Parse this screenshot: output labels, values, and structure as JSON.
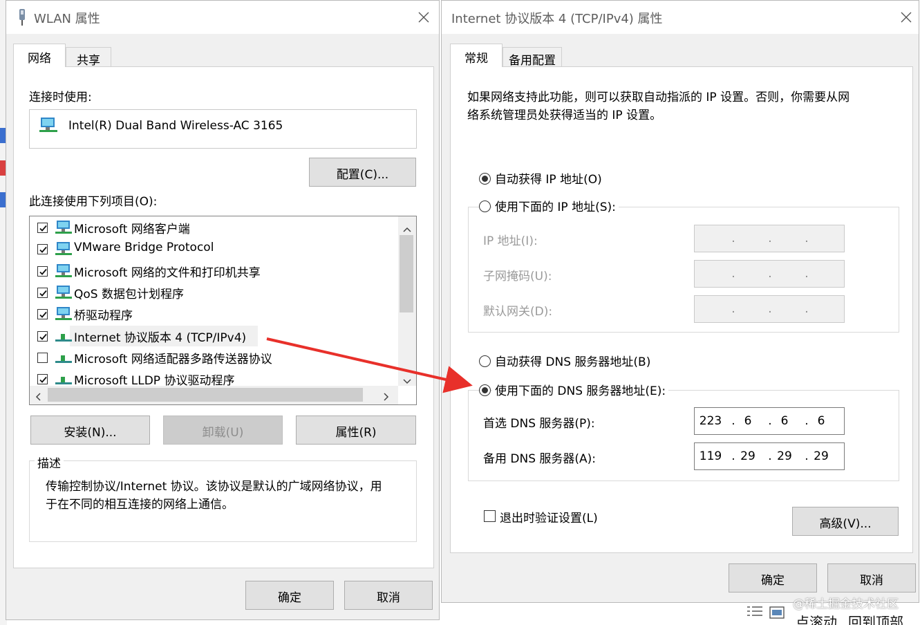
{
  "wlan_window": {
    "title": "WLAN 属性",
    "tabs": [
      "网络",
      "共享"
    ],
    "connect_using_label": "连接时使用:",
    "adapter_name": "Intel(R) Dual Band Wireless-AC 3165",
    "configure_button": "配置(C)...",
    "items_label": "此连接使用下列项目(O):",
    "items": [
      {
        "label": "Microsoft 网络客户端",
        "checked": true,
        "icon": "network-client-icon"
      },
      {
        "label": "VMware Bridge Protocol",
        "checked": true,
        "icon": "network-client-icon"
      },
      {
        "label": "Microsoft 网络的文件和打印机共享",
        "checked": true,
        "icon": "network-client-icon"
      },
      {
        "label": "QoS 数据包计划程序",
        "checked": true,
        "icon": "network-client-icon"
      },
      {
        "label": "桥驱动程序",
        "checked": true,
        "icon": "network-client-icon"
      },
      {
        "label": "Internet 协议版本 4 (TCP/IPv4)",
        "checked": true,
        "icon": "protocol-icon"
      },
      {
        "label": "Microsoft 网络适配器多路传送器协议",
        "checked": false,
        "icon": "protocol-icon"
      },
      {
        "label": "Microsoft LLDP 协议驱动程序",
        "checked": true,
        "icon": "protocol-icon"
      }
    ],
    "install_button": "安装(N)...",
    "uninstall_button": "卸载(U)",
    "properties_button": "属性(R)",
    "description_title": "描述",
    "description_text_line1": "传输控制协议/Internet 协议。该协议是默认的广域网络协议，用",
    "description_text_line2": "于在不同的相互连接的网络上通信。",
    "ok_button": "确定",
    "cancel_button": "取消"
  },
  "ipv4_window": {
    "title": "Internet 协议版本 4 (TCP/IPv4) 属性",
    "tabs": [
      "常规",
      "备用配置"
    ],
    "intro_line1": "如果网络支持此功能，则可以获取自动指派的 IP 设置。否则，你需要从网",
    "intro_line2": "络系统管理员处获得适当的 IP 设置。",
    "auto_ip_label": "自动获得 IP 地址(O)",
    "auto_ip_selected": true,
    "manual_ip_label": "使用下面的 IP 地址(S):",
    "ip_address_label": "IP 地址(I):",
    "subnet_label": "子网掩码(U):",
    "gateway_label": "默认网关(D):",
    "ip_address": [
      "",
      "",
      "",
      ""
    ],
    "subnet": [
      "",
      "",
      "",
      ""
    ],
    "gateway": [
      "",
      "",
      "",
      ""
    ],
    "auto_dns_label": "自动获得 DNS 服务器地址(B)",
    "manual_dns_label": "使用下面的 DNS 服务器地址(E):",
    "manual_dns_selected": true,
    "preferred_dns_label": "首选 DNS 服务器(P):",
    "alternate_dns_label": "备用 DNS 服务器(A):",
    "preferred_dns": [
      "223",
      "6",
      "6",
      "6"
    ],
    "alternate_dns": [
      "119",
      "29",
      "29",
      "29"
    ],
    "validate_label": "退出时验证设置(L)",
    "validate_checked": false,
    "advanced_button": "高级(V)...",
    "ok_button": "确定",
    "cancel_button": "取消"
  },
  "annotation": {
    "arrow_color": "#e8302a"
  },
  "watermark": "@稀土掘金技术社区",
  "footer": {
    "scroll_text": "点滚动",
    "back_to_top": "回到顶部"
  },
  "colors": {
    "title_gray": "#5e5e5e",
    "panel_bg": "#f0f0f0",
    "accent_arrow": "#e8302a"
  }
}
